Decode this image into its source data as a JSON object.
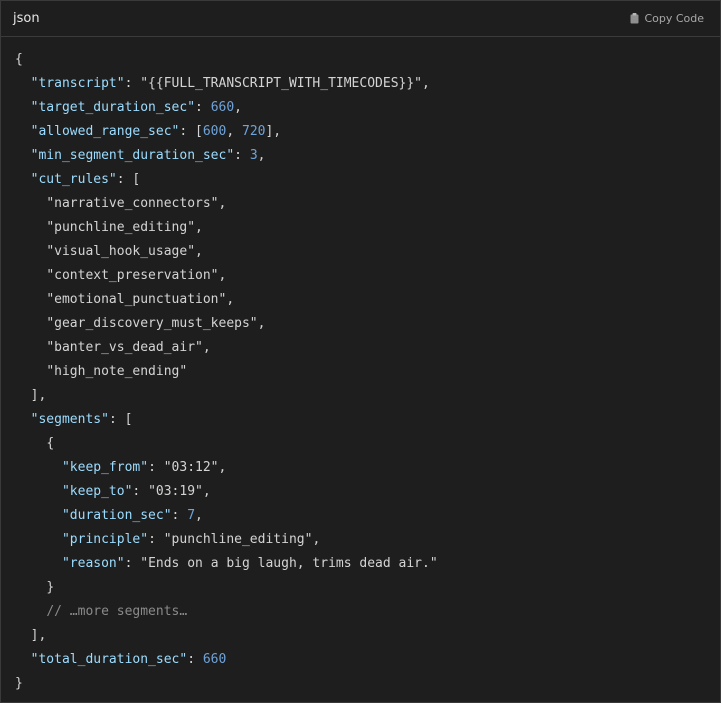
{
  "header": {
    "language": "json",
    "copy_label": "Copy Code",
    "copy_icon": "clipboard-icon"
  },
  "code": {
    "transcript_key": "\"transcript\"",
    "transcript_val": "\"{{FULL_TRANSCRIPT_WITH_TIMECODES}}\"",
    "target_key": "\"target_duration_sec\"",
    "target_val": "660",
    "allowed_key": "\"allowed_range_sec\"",
    "allowed_min": "600",
    "allowed_max": "720",
    "minseg_key": "\"min_segment_duration_sec\"",
    "minseg_val": "3",
    "cutrules_key": "\"cut_rules\"",
    "cut_rules": [
      "\"narrative_connectors\"",
      "\"punchline_editing\"",
      "\"visual_hook_usage\"",
      "\"context_preservation\"",
      "\"emotional_punctuation\"",
      "\"gear_discovery_must_keeps\"",
      "\"banter_vs_dead_air\"",
      "\"high_note_ending\""
    ],
    "segments_key": "\"segments\"",
    "seg_keep_from_key": "\"keep_from\"",
    "seg_keep_from_val": "\"03:12\"",
    "seg_keep_to_key": "\"keep_to\"",
    "seg_keep_to_val": "\"03:19\"",
    "seg_duration_key": "\"duration_sec\"",
    "seg_duration_val": "7",
    "seg_principle_key": "\"principle\"",
    "seg_principle_val": "\"punchline_editing\"",
    "seg_reason_key": "\"reason\"",
    "seg_reason_val": "\"Ends on a big laugh, trims dead air.\"",
    "more_comment": "// …more segments…",
    "total_key": "\"total_duration_sec\"",
    "total_val": "660"
  }
}
